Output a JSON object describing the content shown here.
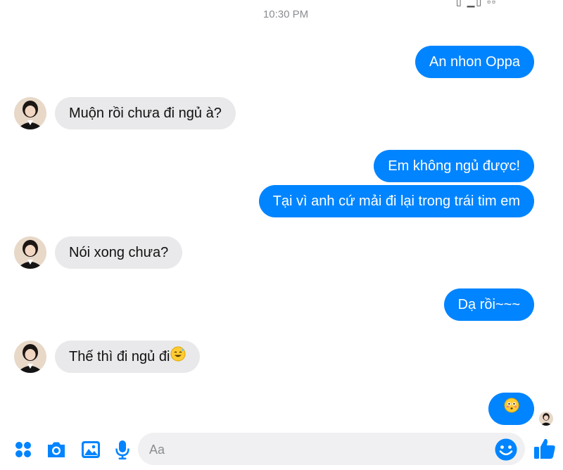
{
  "top_partial_glyphs": "▯  ▁▯  ▫▫",
  "timestamp": "10:30 PM",
  "messages": [
    {
      "direction": "outgoing",
      "text": "An nhon Oppa"
    },
    {
      "direction": "incoming",
      "text": "Muộn rồi chưa đi ngủ à?"
    },
    {
      "direction": "outgoing",
      "text": "Em không ngủ được!"
    },
    {
      "direction": "outgoing",
      "text": "Tại vì anh cứ mải đi lại trong trái tim em"
    },
    {
      "direction": "incoming",
      "text": "Nói xong chưa?"
    },
    {
      "direction": "outgoing",
      "text": "Dạ rồi~~~"
    },
    {
      "direction": "incoming",
      "text": "Thế thì đi ngủ đi",
      "emoji": "smiling-sweat-emoji"
    },
    {
      "direction": "outgoing",
      "text": "",
      "emoji": "flushed-face-emoji"
    }
  ],
  "composer": {
    "placeholder": "Aa",
    "value": "",
    "tools": [
      "apps-grid-icon",
      "camera-icon",
      "gallery-icon",
      "microphone-icon"
    ],
    "emoji_icon": "smiley-icon",
    "like_icon": "thumbs-up-icon"
  },
  "colors": {
    "accent": "#0084ff",
    "incoming_bubble": "#e9e9eb",
    "timestamp": "#8a8d91",
    "input_background": "#f0f0f2"
  }
}
